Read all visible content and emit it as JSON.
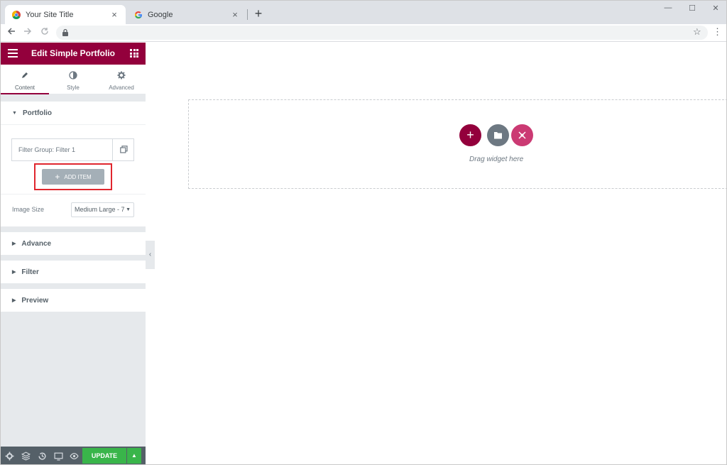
{
  "browser": {
    "tabs": [
      {
        "title": "Your Site Title",
        "icon": "chrome-icon",
        "active": true
      },
      {
        "title": "Google",
        "icon": "google-icon",
        "active": false
      }
    ],
    "new_tab_label": "+",
    "window_controls": {
      "minimize": "—",
      "maximize": "☐",
      "close": "✕"
    }
  },
  "editor": {
    "header_title": "Edit Simple Portfolio",
    "tabs": [
      {
        "label": "Content",
        "icon": "pencil-icon",
        "active": true
      },
      {
        "label": "Style",
        "icon": "contrast-icon",
        "active": false
      },
      {
        "label": "Advanced",
        "icon": "gear-icon",
        "active": false
      }
    ],
    "sections": [
      {
        "title": "Portfolio",
        "expanded": true
      },
      {
        "title": "Advance",
        "expanded": false
      },
      {
        "title": "Filter",
        "expanded": false
      },
      {
        "title": "Preview",
        "expanded": false
      }
    ],
    "repeater_item": "Filter Group: Filter 1",
    "add_item_label": "ADD ITEM",
    "image_size_label": "Image Size",
    "image_size_value": "Medium Large - 7",
    "update_label": "UPDATE",
    "accent_color": "#93003c",
    "update_color": "#39b54a"
  },
  "canvas": {
    "drag_hint": "Drag widget here"
  }
}
